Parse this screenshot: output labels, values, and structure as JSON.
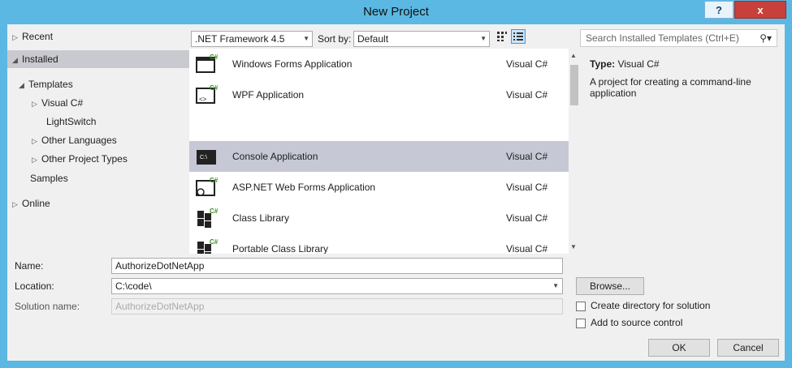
{
  "window": {
    "title": "New Project",
    "help_label": "?",
    "close_label": "x"
  },
  "left_tree": {
    "recent": "Recent",
    "installed": "Installed",
    "templates": "Templates",
    "visual_csharp": "Visual C#",
    "lightswitch": "LightSwitch",
    "other_languages": "Other Languages",
    "other_project_types": "Other Project Types",
    "samples": "Samples",
    "online": "Online"
  },
  "toolbar": {
    "framework": ".NET Framework 4.5",
    "sort_by_label": "Sort by:",
    "sort_value": "Default",
    "search_placeholder": "Search Installed Templates (Ctrl+E)"
  },
  "templates": [
    {
      "name": "Windows Forms Application",
      "lang": "Visual C#",
      "icon": "winforms-icon"
    },
    {
      "name": "WPF Application",
      "lang": "Visual C#",
      "icon": "wpf-icon"
    },
    {
      "name": "Console Application",
      "lang": "Visual C#",
      "icon": "console-icon"
    },
    {
      "name": "ASP.NET Web Forms Application",
      "lang": "Visual C#",
      "icon": "aspnet-icon"
    },
    {
      "name": "Class Library",
      "lang": "Visual C#",
      "icon": "class-library-icon"
    },
    {
      "name": "Portable Class Library",
      "lang": "Visual C#",
      "icon": "portable-library-icon"
    }
  ],
  "details": {
    "type_label": "Type:",
    "type_value": "Visual C#",
    "description": "A project for creating a command-line application"
  },
  "form": {
    "name_label": "Name:",
    "name_value": "AuthorizeDotNetApp",
    "location_label": "Location:",
    "location_value": "C:\\code\\",
    "solution_label": "Solution name:",
    "solution_value": "AuthorizeDotNetApp",
    "browse": "Browse...",
    "create_dir": "Create directory for solution",
    "add_source": "Add to source control",
    "ok": "OK",
    "cancel": "Cancel"
  }
}
